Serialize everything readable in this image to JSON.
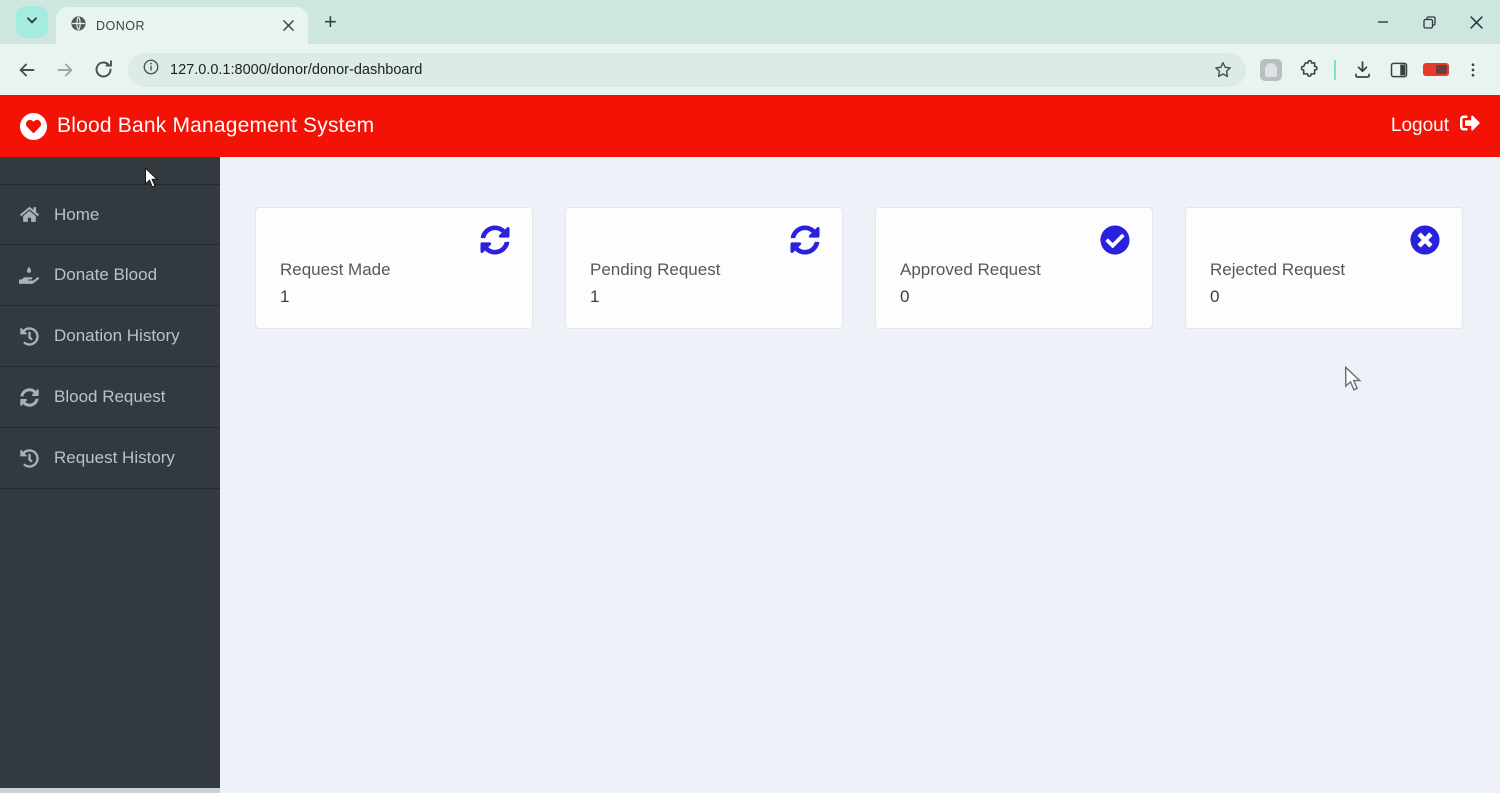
{
  "browser": {
    "tab_title": "DONOR",
    "new_tab_button": "+",
    "url": "127.0.0.1:8000/donor/donor-dashboard"
  },
  "header": {
    "title": "Blood Bank Management System",
    "logout_label": "Logout"
  },
  "sidebar": {
    "items": [
      {
        "label": "Home",
        "icon": "home-icon"
      },
      {
        "label": "Donate Blood",
        "icon": "hand-holding-drop-icon"
      },
      {
        "label": "Donation History",
        "icon": "history-icon"
      },
      {
        "label": "Blood Request",
        "icon": "sync-icon"
      },
      {
        "label": "Request History",
        "icon": "history-icon"
      }
    ]
  },
  "main": {
    "cards": [
      {
        "label": "Request Made",
        "value": "1",
        "icon": "sync-icon"
      },
      {
        "label": "Pending Request",
        "value": "1",
        "icon": "sync-icon"
      },
      {
        "label": "Approved Request",
        "value": "0",
        "icon": "check-circle-icon"
      },
      {
        "label": "Rejected Request",
        "value": "0",
        "icon": "times-circle-icon"
      }
    ]
  },
  "colors": {
    "header_red": "#f41106",
    "icon_blue": "#2a21dd",
    "sidebar_dark": "#323a40",
    "main_bg": "#eef2f8",
    "chrome_mint": "#cde7e0"
  }
}
